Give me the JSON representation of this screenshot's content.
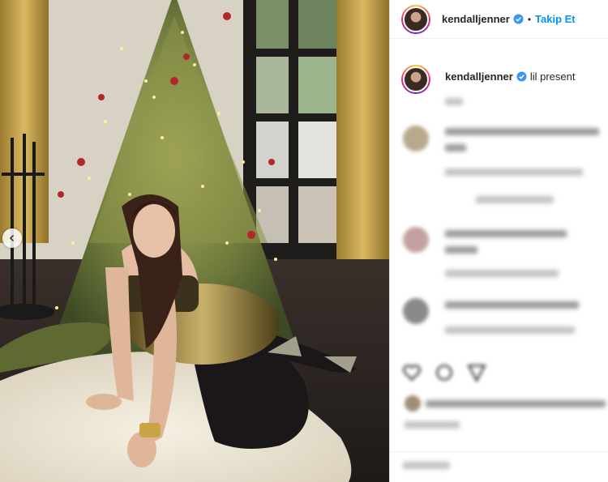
{
  "post": {
    "username": "kendalljenner",
    "follow_label": "Takip Et",
    "separator": "•",
    "caption": "lil present"
  },
  "colors": {
    "follow_blue": "#0095f6",
    "verified_blue": "#3897f0",
    "story_ring": [
      "#f9ce34",
      "#ee2a7b",
      "#6228d7"
    ]
  },
  "icons": {
    "verified": "verified-badge-icon",
    "carousel_prev": "chevron-left-icon",
    "like": "heart-icon",
    "comment": "comment-icon",
    "share": "paper-plane-icon"
  }
}
